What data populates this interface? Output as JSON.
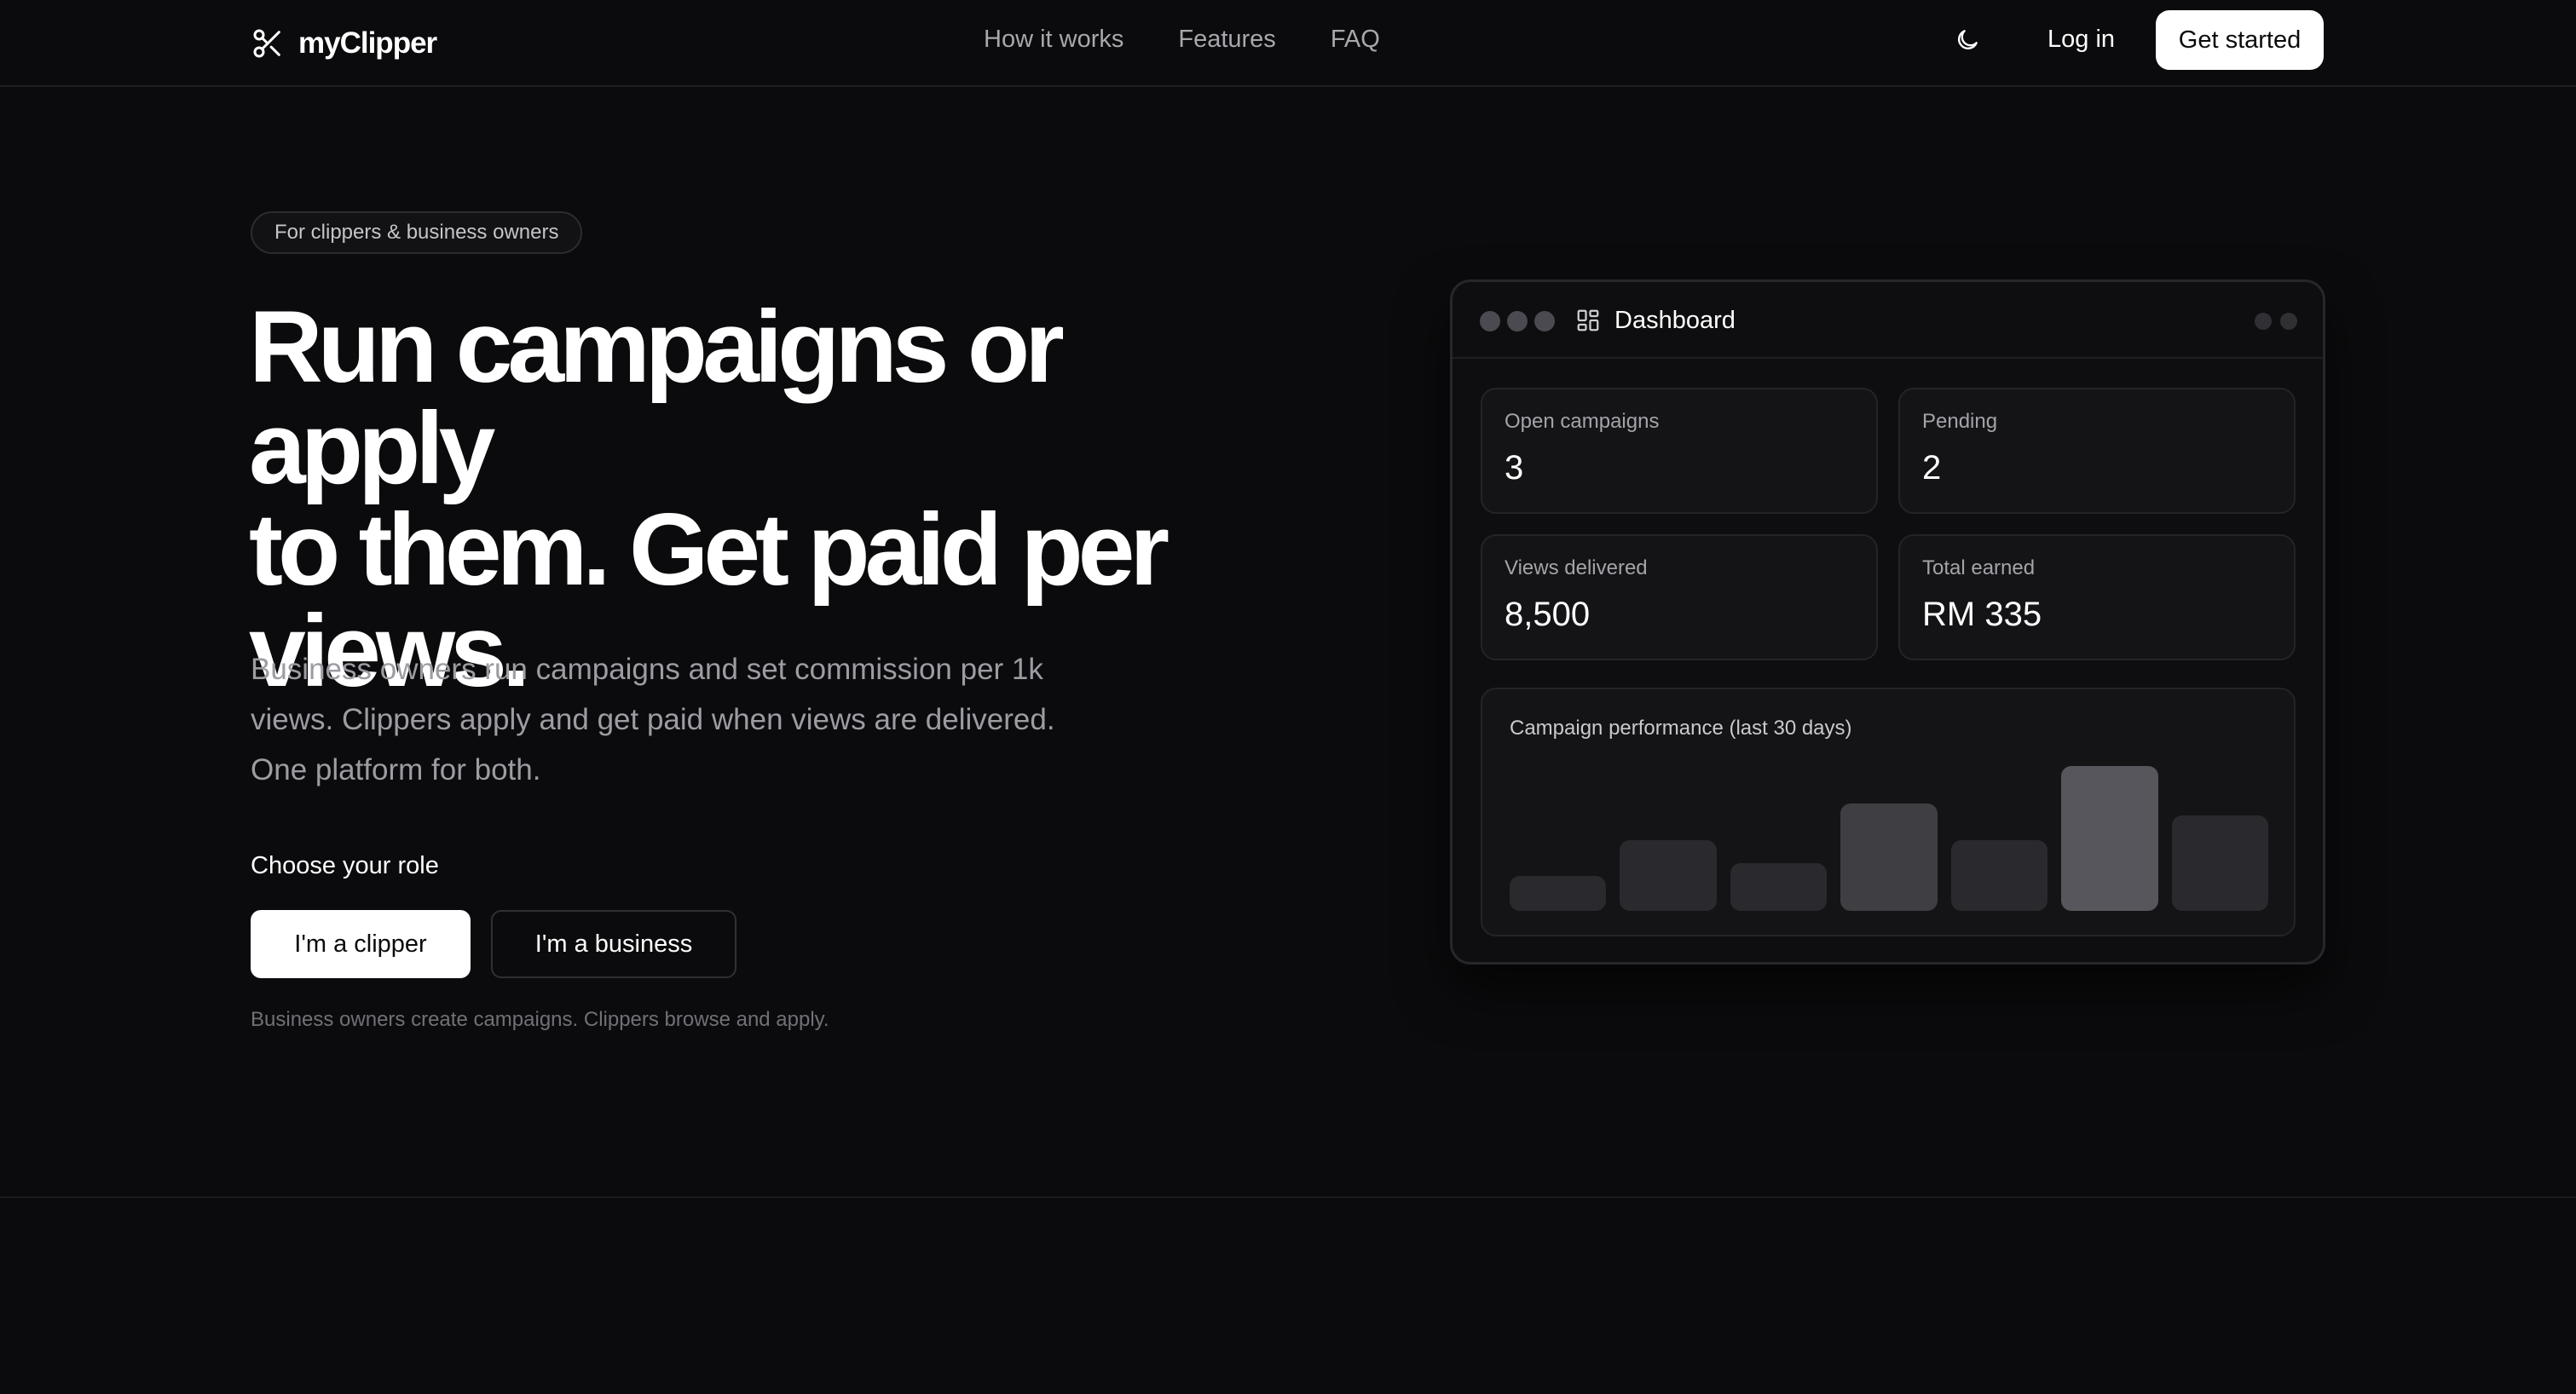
{
  "nav": {
    "brand": "myClipper",
    "links": [
      "How it works",
      "Features",
      "FAQ"
    ],
    "login": "Log in",
    "cta": "Get started"
  },
  "hero": {
    "pill": "For clippers & business owners",
    "headline_lines": [
      "Run campaigns or apply",
      "to them. Get paid per",
      "views."
    ],
    "subtext_lines": [
      "Business owners run campaigns and set commission per 1k",
      "views. Clippers apply and get paid when views are delivered.",
      "One platform for both."
    ],
    "role_label": "Choose your role",
    "clipper_button": "I'm a clipper",
    "business_button": "I'm a business",
    "foot_note": "Business owners create campaigns. Clippers browse and apply."
  },
  "dashboard": {
    "title": "Dashboard",
    "stats": [
      {
        "label": "Open campaigns",
        "value": "3"
      },
      {
        "label": "Pending",
        "value": "2"
      },
      {
        "label": "Views delivered",
        "value": "8,500"
      },
      {
        "label": "Total earned",
        "value": "RM 335"
      }
    ],
    "performance_title": "Campaign performance (last 30 days)"
  },
  "chart_data": {
    "type": "bar",
    "title": "Campaign performance (last 30 days)",
    "values": [
      0.24,
      0.49,
      0.33,
      0.74,
      0.49,
      1.0,
      0.66
    ],
    "highlight_index": [
      3,
      5
    ],
    "colors": {
      "normal": "#2a2a2e",
      "mid": "#3e3e43",
      "peak": "#56565c"
    }
  },
  "icons": {
    "brand": "scissors-icon",
    "theme": "moon-icon",
    "dashboard": "grid-icon"
  }
}
